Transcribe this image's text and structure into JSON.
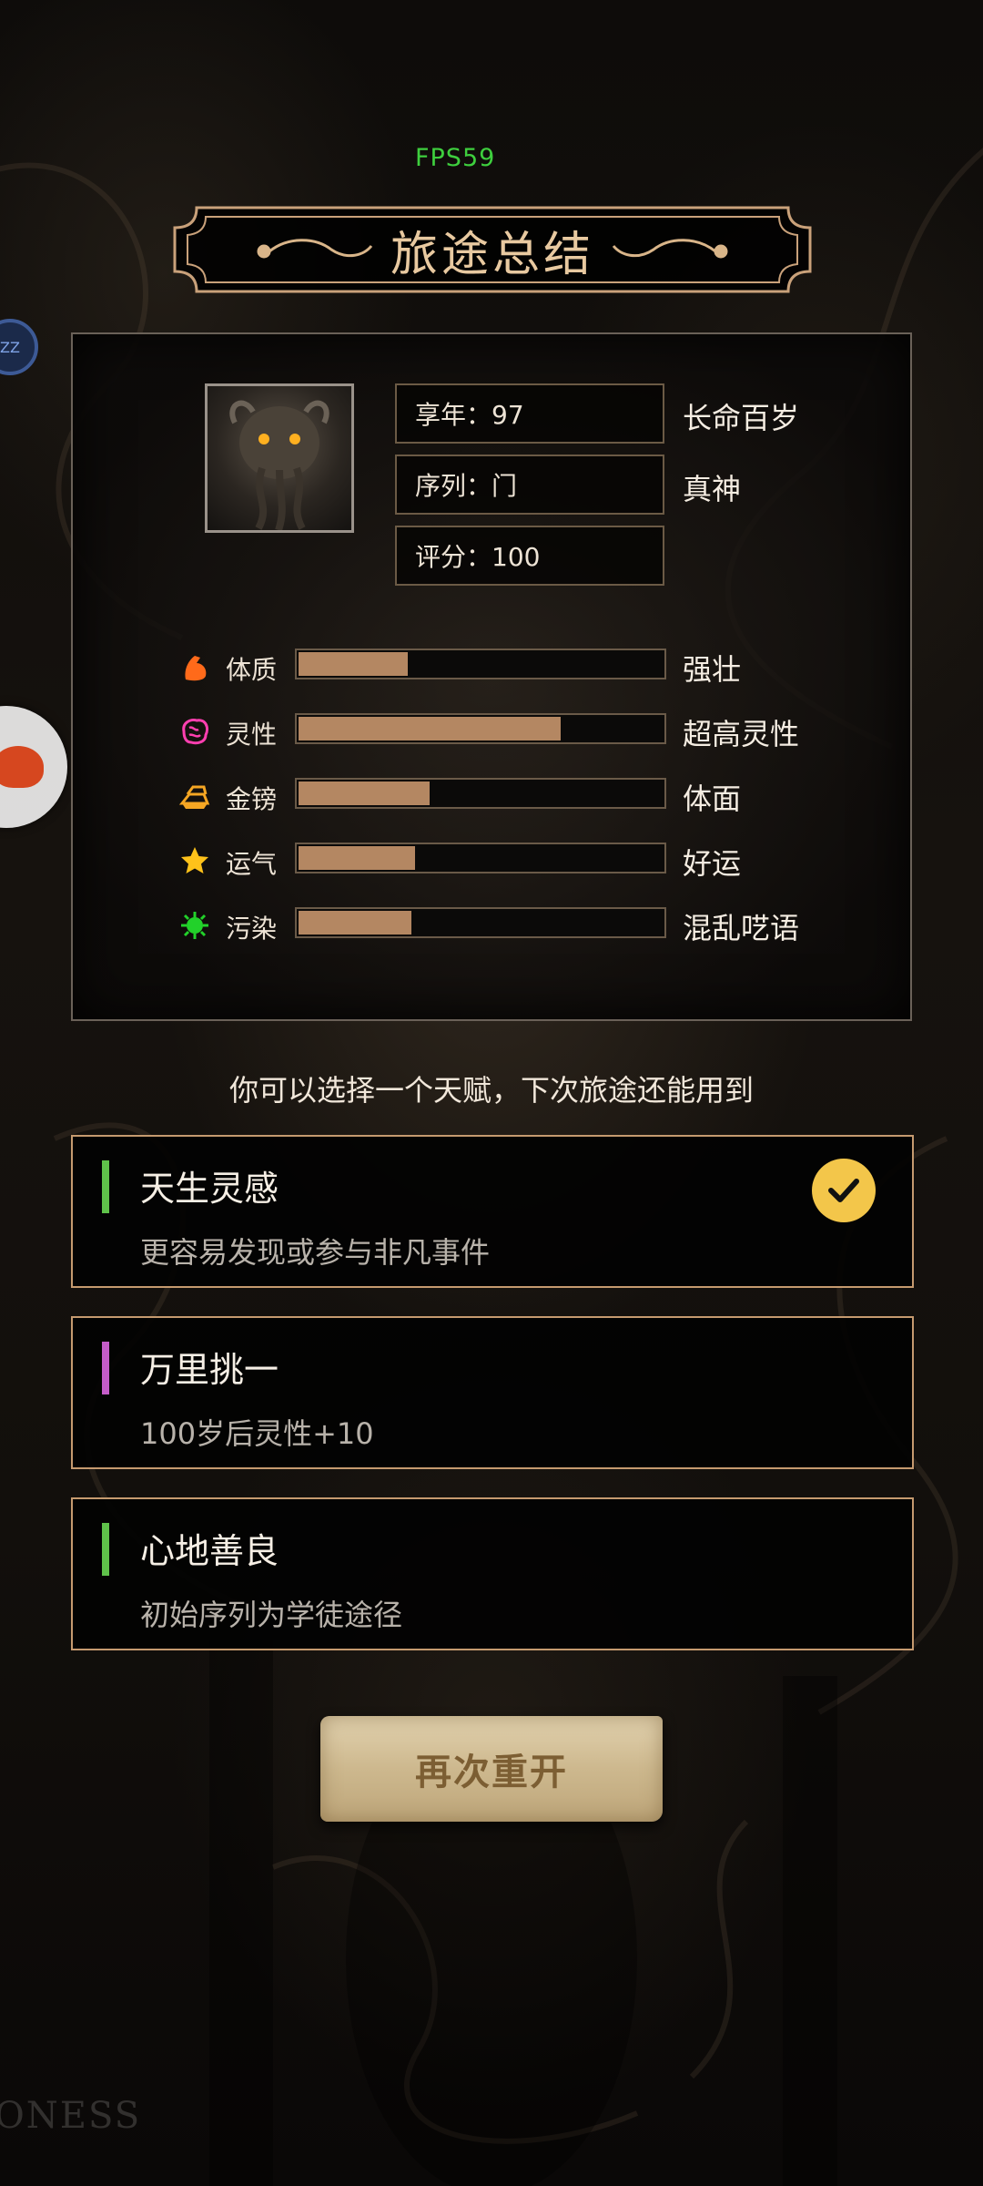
{
  "fps": "FPS59",
  "title": "旅途总结",
  "side_badge": "ZZ",
  "info": [
    {
      "text": "享年：97",
      "tag": "长命百岁"
    },
    {
      "text": "序列：门",
      "tag": "真神"
    },
    {
      "text": "评分：100",
      "tag": ""
    }
  ],
  "stats": [
    {
      "label": "体质",
      "desc": "强壮",
      "value": 0.3,
      "icon": "muscle-icon",
      "color": "#ff6a1a"
    },
    {
      "label": "灵性",
      "desc": "超高灵性",
      "value": 0.72,
      "icon": "brain-icon",
      "color": "#ff3fb0"
    },
    {
      "label": "金镑",
      "desc": "体面",
      "value": 0.36,
      "icon": "gold-bars-icon",
      "color": "#f5a623"
    },
    {
      "label": "运气",
      "desc": "好运",
      "value": 0.32,
      "icon": "star-icon",
      "color": "#ffc21a"
    },
    {
      "label": "污染",
      "desc": "混乱呓语",
      "value": 0.31,
      "icon": "virus-icon",
      "color": "#22d12a"
    }
  ],
  "prompt": "你可以选择一个天赋，下次旅途还能用到",
  "talents": [
    {
      "name": "天生灵感",
      "desc": "更容易发现或参与非凡事件",
      "accent": "#5fc24a",
      "selected": true
    },
    {
      "name": "万里挑一",
      "desc": "100岁后灵性+10",
      "accent": "#c45cc8",
      "selected": false
    },
    {
      "name": "心地善良",
      "desc": "初始序列为学徒途径",
      "accent": "#5fc24a",
      "selected": false
    }
  ],
  "restart_label": "再次重开",
  "watermark": "ONESS"
}
